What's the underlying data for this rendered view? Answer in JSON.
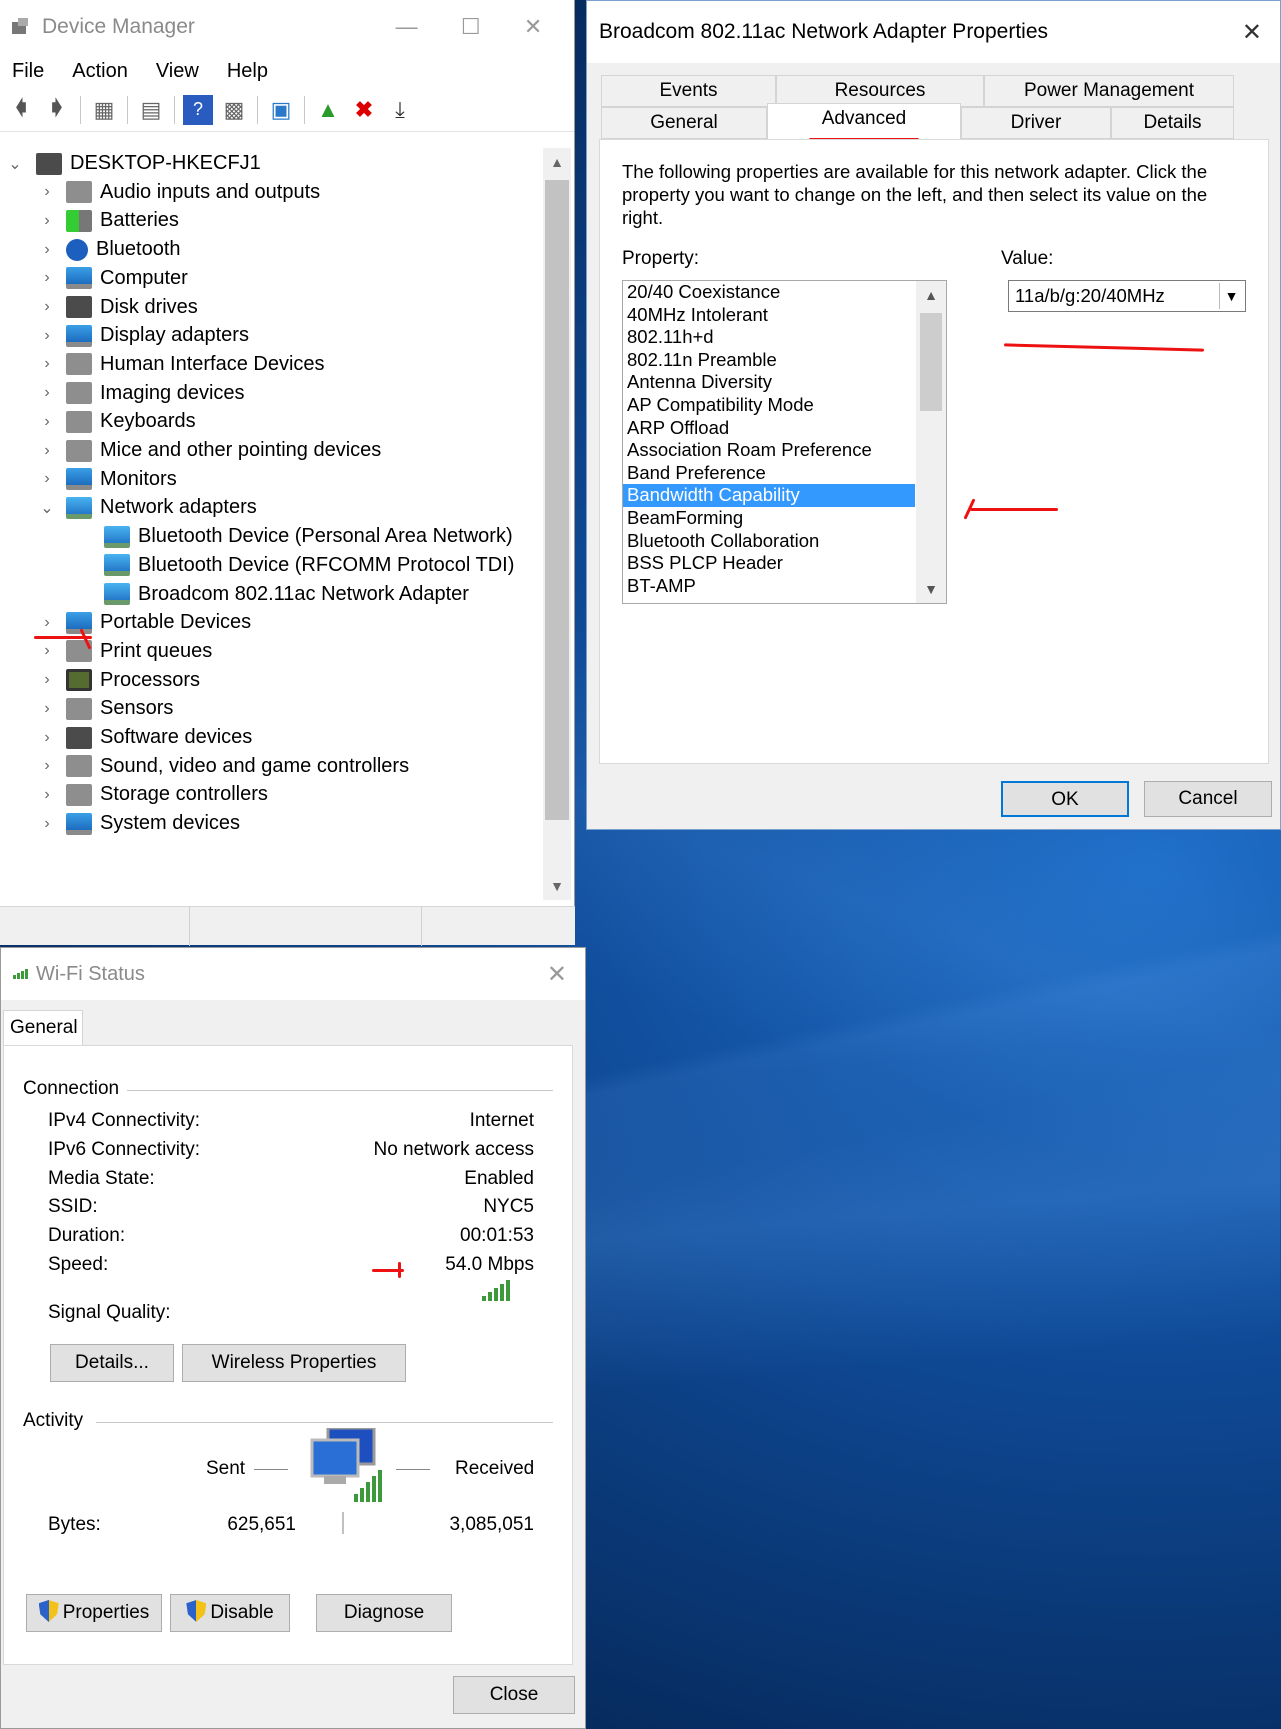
{
  "device_manager": {
    "title": "Device Manager",
    "menu": [
      "File",
      "Action",
      "View",
      "Help"
    ],
    "toolbar_icons": [
      "back-arrow-icon",
      "forward-arrow-icon",
      "properties-icon",
      "update-icon",
      "help-icon",
      "view-icon",
      "scan-hardware-icon",
      "add-driver-icon",
      "uninstall-x-icon",
      "download-icon"
    ],
    "tree": {
      "root": "DESKTOP-HKECFJ1",
      "categories": [
        {
          "label": "Audio inputs and outputs",
          "icon": "speaker-icon"
        },
        {
          "label": "Batteries",
          "icon": "battery-icon"
        },
        {
          "label": "Bluetooth",
          "icon": "bluetooth-icon"
        },
        {
          "label": "Computer",
          "icon": "monitor-icon"
        },
        {
          "label": "Disk drives",
          "icon": "disk-drive-icon"
        },
        {
          "label": "Display adapters",
          "icon": "display-adapter-icon"
        },
        {
          "label": "Human Interface Devices",
          "icon": "hid-icon"
        },
        {
          "label": "Imaging devices",
          "icon": "camera-icon"
        },
        {
          "label": "Keyboards",
          "icon": "keyboard-icon"
        },
        {
          "label": "Mice and other pointing devices",
          "icon": "mouse-icon"
        },
        {
          "label": "Monitors",
          "icon": "monitor-icon"
        },
        {
          "label": "Network adapters",
          "icon": "network-icon"
        }
      ],
      "network_children": [
        "Bluetooth Device (Personal Area Network)",
        "Bluetooth Device (RFCOMM Protocol TDI)",
        "Broadcom 802.11ac Network Adapter"
      ],
      "categories_after": [
        {
          "label": "Portable Devices",
          "icon": "portable-device-icon"
        },
        {
          "label": "Print queues",
          "icon": "printer-icon"
        },
        {
          "label": "Processors",
          "icon": "processor-icon"
        },
        {
          "label": "Sensors",
          "icon": "sensor-icon"
        },
        {
          "label": "Software devices",
          "icon": "software-device-icon"
        },
        {
          "label": "Sound, video and game controllers",
          "icon": "speaker-icon"
        },
        {
          "label": "Storage controllers",
          "icon": "storage-icon"
        },
        {
          "label": "System devices",
          "icon": "system-folder-icon"
        }
      ]
    }
  },
  "properties_dialog": {
    "title": "Broadcom 802.11ac Network Adapter Properties",
    "tabs_row1": [
      "Events",
      "Resources",
      "Power Management"
    ],
    "tabs_row2": [
      "General",
      "Advanced",
      "Driver",
      "Details"
    ],
    "active_tab": "Advanced",
    "description": "The following properties are available for this network adapter. Click the property you want to change on the left, and then select its value on the right.",
    "property_label": "Property:",
    "value_label": "Value:",
    "properties": [
      "20/40 Coexistance",
      "40MHz Intolerant",
      "802.11h+d",
      "802.11n Preamble",
      "Antenna Diversity",
      "AP Compatibility Mode",
      "ARP Offload",
      "Association Roam Preference",
      "Band Preference",
      "Bandwidth Capability",
      "BeamForming",
      "Bluetooth Collaboration",
      "BSS PLCP Header",
      "BT-AMP"
    ],
    "selected_property": "Bandwidth Capability",
    "value": "11a/b/g:20/40MHz",
    "ok": "OK",
    "cancel": "Cancel"
  },
  "wifi_status": {
    "title": "Wi-Fi Status",
    "tab": "General",
    "connection_title": "Connection",
    "rows": [
      {
        "label": "IPv4 Connectivity:",
        "value": "Internet"
      },
      {
        "label": "IPv6 Connectivity:",
        "value": "No network access"
      },
      {
        "label": "Media State:",
        "value": "Enabled"
      },
      {
        "label": "SSID:",
        "value": "NYC5"
      },
      {
        "label": "Duration:",
        "value": "00:01:53"
      },
      {
        "label": "Speed:",
        "value": "54.0 Mbps"
      }
    ],
    "signal_label": "Signal Quality:",
    "signal_bars": 5,
    "details_btn": "Details...",
    "wireless_btn": "Wireless Properties",
    "activity_title": "Activity",
    "sent_label": "Sent",
    "received_label": "Received",
    "bytes_label": "Bytes:",
    "bytes_sent": "625,651",
    "bytes_received": "3,085,051",
    "properties_btn": "Properties",
    "disable_btn": "Disable",
    "diagnose_btn": "Diagnose",
    "close_btn": "Close"
  },
  "annotation_color": "#e11111"
}
